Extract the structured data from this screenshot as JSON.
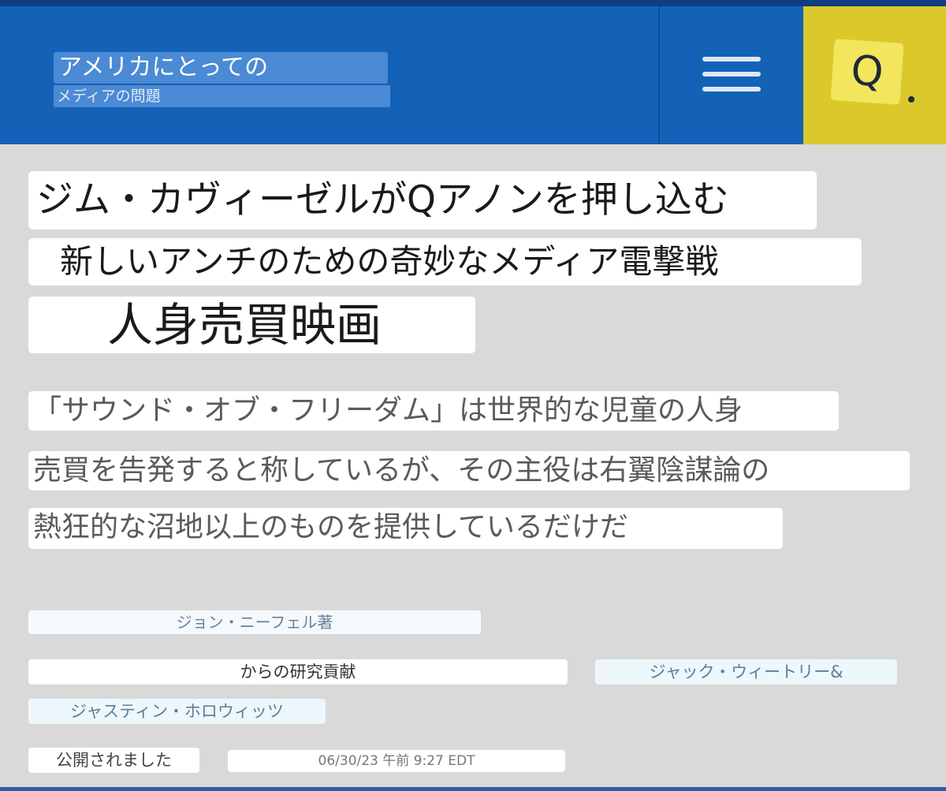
{
  "header": {
    "logo_line1": "アメリカにとっての",
    "logo_line2": "メディアの問題",
    "menu_icon": "hamburger-menu-icon",
    "search_label": "Q"
  },
  "article": {
    "headline_lines": [
      "ジム・カヴィーゼルがQアノンを押し込む",
      "新しいアンチのための奇妙なメディア電撃戦",
      "人身売買映画"
    ],
    "subheading_lines": [
      "「サウンド・オブ・フリーダム」は世界的な児童の人身",
      "売買を告発すると称しているが、その主役は右翼陰謀論の",
      "熱狂的な沼地以上のものを提供しているだけだ"
    ],
    "author": "ジョン・ニーフェル著",
    "contributions_label": "からの研究貢献",
    "contributors": [
      "ジャック・ウィートリー&",
      "ジャスティン・ホロウィッツ"
    ],
    "published_label": "公開されました",
    "published_datetime": "06/30/23 午前 9:27 EDT"
  },
  "colors": {
    "header_blue": "#1462b8",
    "search_yellow": "#dbc92c",
    "page_background": "#d9d9d9"
  }
}
